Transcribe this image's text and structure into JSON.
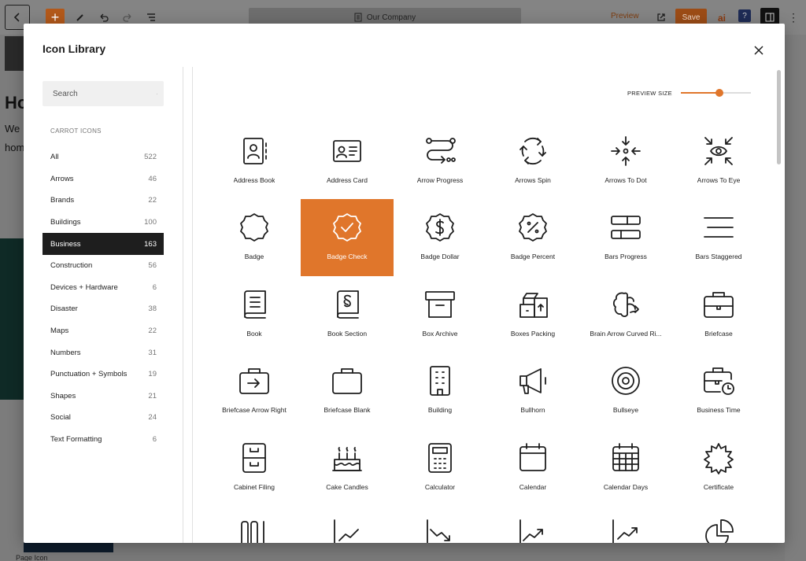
{
  "editor": {
    "doc_title": "Our Company",
    "preview_label": "Preview",
    "save_label": "Save",
    "bg_heading": "Ho",
    "bg_text_1": "We",
    "bg_text_2": "hom",
    "breadcrumb": "Page   Icon"
  },
  "modal": {
    "title": "Icon Library",
    "search_placeholder": "Search",
    "section_title": "CARROT ICONS",
    "preview_size_label": "PREVIEW SIZE",
    "preview_size_value": 0.55,
    "accent_color": "#e0762b",
    "categories": [
      {
        "label": "All",
        "count": "522"
      },
      {
        "label": "Arrows",
        "count": "46"
      },
      {
        "label": "Brands",
        "count": "22"
      },
      {
        "label": "Buildings",
        "count": "100"
      },
      {
        "label": "Business",
        "count": "163",
        "active": true
      },
      {
        "label": "Construction",
        "count": "56"
      },
      {
        "label": "Devices + Hardware",
        "count": "6"
      },
      {
        "label": "Disaster",
        "count": "38"
      },
      {
        "label": "Maps",
        "count": "22"
      },
      {
        "label": "Numbers",
        "count": "31"
      },
      {
        "label": "Punctuation + Symbols",
        "count": "19"
      },
      {
        "label": "Shapes",
        "count": "21"
      },
      {
        "label": "Social",
        "count": "24"
      },
      {
        "label": "Text Formatting",
        "count": "6"
      }
    ],
    "icons": [
      {
        "label": "Address Book",
        "icon": "address-book"
      },
      {
        "label": "Address Card",
        "icon": "address-card"
      },
      {
        "label": "Arrow Progress",
        "icon": "arrow-progress"
      },
      {
        "label": "Arrows Spin",
        "icon": "arrows-spin"
      },
      {
        "label": "Arrows To Dot",
        "icon": "arrows-to-dot"
      },
      {
        "label": "Arrows To Eye",
        "icon": "arrows-to-eye"
      },
      {
        "label": "Badge",
        "icon": "badge"
      },
      {
        "label": "Badge Check",
        "icon": "badge-check",
        "selected": true
      },
      {
        "label": "Badge Dollar",
        "icon": "badge-dollar"
      },
      {
        "label": "Badge Percent",
        "icon": "badge-percent"
      },
      {
        "label": "Bars Progress",
        "icon": "bars-progress"
      },
      {
        "label": "Bars Staggered",
        "icon": "bars-staggered"
      },
      {
        "label": "Book",
        "icon": "book"
      },
      {
        "label": "Book Section",
        "icon": "book-section"
      },
      {
        "label": "Box Archive",
        "icon": "box-archive"
      },
      {
        "label": "Boxes Packing",
        "icon": "boxes-packing"
      },
      {
        "label": "Brain Arrow Curved Ri...",
        "icon": "brain-arrow-curved-right"
      },
      {
        "label": "Briefcase",
        "icon": "briefcase"
      },
      {
        "label": "Briefcase Arrow Right",
        "icon": "briefcase-arrow-right"
      },
      {
        "label": "Briefcase Blank",
        "icon": "briefcase-blank"
      },
      {
        "label": "Building",
        "icon": "building"
      },
      {
        "label": "Bullhorn",
        "icon": "bullhorn"
      },
      {
        "label": "Bullseye",
        "icon": "bullseye"
      },
      {
        "label": "Business Time",
        "icon": "business-time"
      },
      {
        "label": "Cabinet Filing",
        "icon": "cabinet-filing"
      },
      {
        "label": "Cake Candles",
        "icon": "cake-candles"
      },
      {
        "label": "Calculator",
        "icon": "calculator"
      },
      {
        "label": "Calendar",
        "icon": "calendar"
      },
      {
        "label": "Calendar Days",
        "icon": "calendar-days"
      },
      {
        "label": "Certificate",
        "icon": "certificate"
      },
      {
        "label": "",
        "icon": "chart-columns"
      },
      {
        "label": "",
        "icon": "chart-line"
      },
      {
        "label": "",
        "icon": "chart-line-down"
      },
      {
        "label": "",
        "icon": "chart-line-up"
      },
      {
        "label": "",
        "icon": "chart-mixed-up"
      },
      {
        "label": "",
        "icon": "chart-pie"
      }
    ]
  }
}
